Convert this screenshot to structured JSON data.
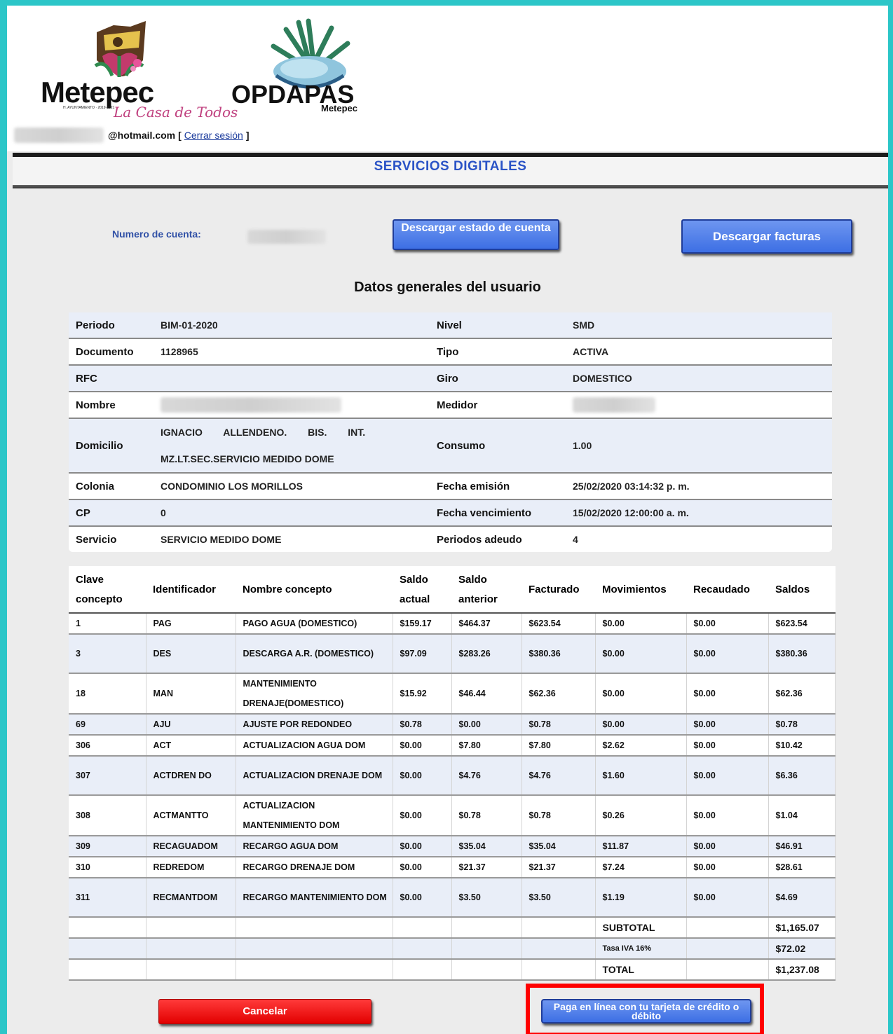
{
  "header": {
    "logo1": {
      "name": "Metepec",
      "small": "H. AYUNTAMIENTO · 2019-2021",
      "script": "La Casa de Todos"
    },
    "logo2": {
      "name": "OPDAPAS",
      "sub": "Metepec"
    },
    "email_suffix": "@hotmail.com",
    "bracket_open": "[",
    "logout": "Cerrar sesión",
    "bracket_close": "]"
  },
  "title": "SERVICIOS DIGITALES",
  "account": {
    "label": "Numero de cuenta:",
    "btn_statement": "Descargar estado de cuenta",
    "btn_invoices": "Descargar facturas"
  },
  "section_title": "Datos generales del usuario",
  "general": [
    {
      "k1": "Periodo",
      "v1": "BIM-01-2020",
      "k2": "Nivel",
      "v2": "SMD"
    },
    {
      "k1": "Documento",
      "v1": "1128965",
      "k2": "Tipo",
      "v2": "ACTIVA"
    },
    {
      "k1": "RFC",
      "v1": "",
      "k2": "Giro",
      "v2": "DOMESTICO"
    },
    {
      "k1": "Nombre",
      "v1": "",
      "k2": "Medidor",
      "v2": ""
    },
    {
      "k1": "Domicilio",
      "v1": "IGNACIO ALLENDENO. BIS. INT.",
      "v1b": "MZ.LT.SEC.SERVICIO MEDIDO DOME",
      "k2": "Consumo",
      "v2": "1.00"
    },
    {
      "k1": "Colonia",
      "v1": "CONDOMINIO LOS MORILLOS",
      "k2": "Fecha emisión",
      "v2": "25/02/2020 03:14:32 p. m."
    },
    {
      "k1": "CP",
      "v1": "0",
      "k2": "Fecha vencimiento",
      "v2": "15/02/2020 12:00:00 a. m."
    },
    {
      "k1": "Servicio",
      "v1": "SERVICIO MEDIDO DOME",
      "k2": "Periodos adeudo",
      "v2": "4"
    }
  ],
  "concepts": {
    "headers": [
      "Clave concepto",
      "Identificador",
      "Nombre concepto",
      "Saldo actual",
      "Saldo anterior",
      "Facturado",
      "Movimientos",
      "Recaudado",
      "Saldos"
    ],
    "rows": [
      [
        "1",
        "PAG",
        "PAGO AGUA (DOMESTICO)",
        "$159.17",
        "$464.37",
        "$623.54",
        "$0.00",
        "$0.00",
        "$623.54"
      ],
      [
        "3",
        "DES",
        "DESCARGA A.R. (DOMESTICO)",
        "$97.09",
        "$283.26",
        "$380.36",
        "$0.00",
        "$0.00",
        "$380.36"
      ],
      [
        "18",
        "MAN",
        "MANTENIMIENTO DRENAJE(DOMESTICO)",
        "$15.92",
        "$46.44",
        "$62.36",
        "$0.00",
        "$0.00",
        "$62.36"
      ],
      [
        "69",
        "AJU",
        "AJUSTE POR REDONDEO",
        "$0.78",
        "$0.00",
        "$0.78",
        "$0.00",
        "$0.00",
        "$0.78"
      ],
      [
        "306",
        "ACT",
        "ACTUALIZACION AGUA DOM",
        "$0.00",
        "$7.80",
        "$7.80",
        "$2.62",
        "$0.00",
        "$10.42"
      ],
      [
        "307",
        "ACTDREN DO",
        "ACTUALIZACION DRENAJE DOM",
        "$0.00",
        "$4.76",
        "$4.76",
        "$1.60",
        "$0.00",
        "$6.36"
      ],
      [
        "308",
        "ACTMANTTO",
        "ACTUALIZACION MANTENIMIENTO DOM",
        "$0.00",
        "$0.78",
        "$0.78",
        "$0.26",
        "$0.00",
        "$1.04"
      ],
      [
        "309",
        "RECAGUADOM",
        "RECARGO AGUA DOM",
        "$0.00",
        "$35.04",
        "$35.04",
        "$11.87",
        "$0.00",
        "$46.91"
      ],
      [
        "310",
        "REDREDOM",
        "RECARGO DRENAJE DOM",
        "$0.00",
        "$21.37",
        "$21.37",
        "$7.24",
        "$0.00",
        "$28.61"
      ],
      [
        "311",
        "RECMANTDOM",
        "RECARGO MANTENIMIENTO DOM",
        "$0.00",
        "$3.50",
        "$3.50",
        "$1.19",
        "$0.00",
        "$4.69"
      ]
    ],
    "subtotal_label": "SUBTOTAL",
    "subtotal": "$1,165.07",
    "iva_label": "Tasa IVA 16%",
    "iva": "$72.02",
    "total_label": "TOTAL",
    "total": "$1,237.08"
  },
  "actions": {
    "cancel": "Cancelar",
    "pay": "Paga en línea con tu tarjeta de crédito o débito"
  },
  "colors": {
    "frame": "#2cc6c8",
    "accent": "#3d6fe4",
    "danger": "#e20000",
    "highlight": "#ff0000"
  }
}
